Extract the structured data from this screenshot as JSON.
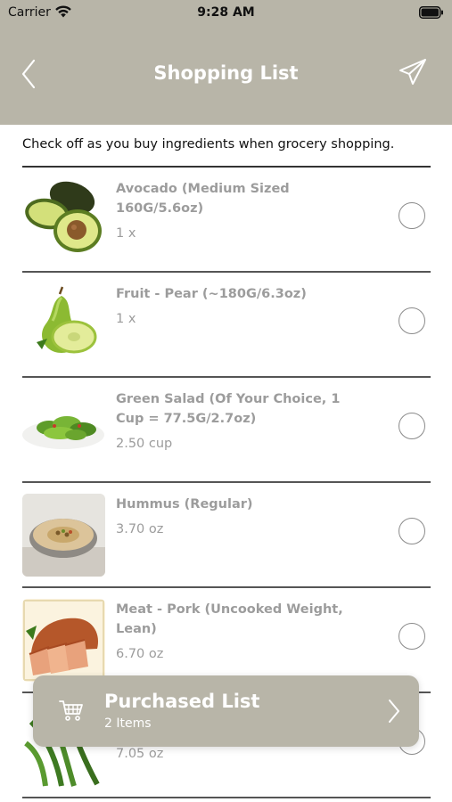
{
  "status_bar": {
    "carrier": "Carrier",
    "time": "9:28 AM",
    "icons": [
      "wifi-icon",
      "battery-icon"
    ]
  },
  "nav": {
    "title": "Shopping List",
    "back_icon": "chevron-left-icon",
    "share_icon": "paper-plane-icon",
    "background_color": "#b8b5a8"
  },
  "intro": "Check off as you buy ingredients when grocery shopping.",
  "items": [
    {
      "name": "Avocado (Medium Sized 160G/5.6oz)",
      "quantity": "1 x",
      "image": "avocado",
      "checked": false
    },
    {
      "name": "Fruit - Pear (~180G/6.3oz)",
      "quantity": "1 x",
      "image": "pear",
      "checked": false
    },
    {
      "name": "Green Salad (Of Your Choice, 1 Cup = 77.5G/2.7oz)",
      "quantity": "2.50 cup",
      "image": "green-salad",
      "checked": false
    },
    {
      "name": "Hummus (Regular)",
      "quantity": "3.70 oz",
      "image": "hummus",
      "checked": false
    },
    {
      "name": "Meat - Pork (Uncooked Weight, Lean)",
      "quantity": "6.70 oz",
      "image": "pork",
      "checked": false
    },
    {
      "name": "",
      "quantity": "7.05 oz",
      "image": "green-beans",
      "checked": false
    }
  ],
  "purchased": {
    "title": "Purchased List",
    "count": "2 Items",
    "icon": "shopping-cart-icon",
    "chevron": "chevron-right-icon"
  },
  "colors": {
    "accent": "#b8b5a8",
    "item_text": "#9c9c9c",
    "divider": "#555555"
  }
}
